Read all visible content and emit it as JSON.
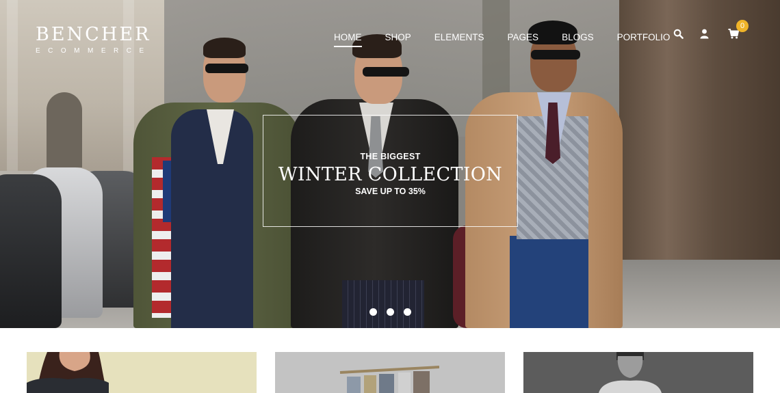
{
  "brand": {
    "name": "BENCHER",
    "tagline": "ECOMMERCE"
  },
  "nav": {
    "items": [
      {
        "label": "HOME",
        "active": true
      },
      {
        "label": "SHOP",
        "active": false
      },
      {
        "label": "ELEMENTS",
        "active": false
      },
      {
        "label": "PAGES",
        "active": false
      },
      {
        "label": "BLOGS",
        "active": false
      },
      {
        "label": "PORTFOLIO",
        "active": false
      }
    ]
  },
  "header_icons": {
    "search": "search-icon",
    "account": "user-icon",
    "cart": "cart-icon",
    "cart_count": "0"
  },
  "hero": {
    "pretitle": "THE BIGGEST",
    "title": "WINTER COLLECTION",
    "subtitle": "SAVE UP TO 35%",
    "slides": 3,
    "active_slide": 1
  },
  "cards": [
    {
      "name": "category-card-women"
    },
    {
      "name": "category-card-accessories"
    },
    {
      "name": "category-card-men"
    }
  ],
  "colors": {
    "accent": "#f0b429",
    "text_on_hero": "#ffffff",
    "background": "#ffffff"
  }
}
